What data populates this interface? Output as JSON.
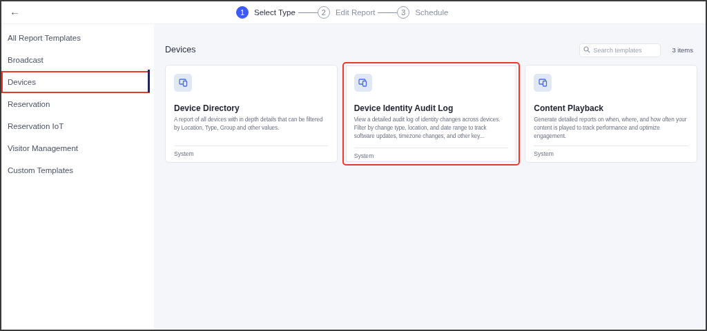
{
  "topbar": {
    "back": "←",
    "steps": [
      {
        "number": "1",
        "label": "Select Type",
        "active": true
      },
      {
        "number": "2",
        "label": "Edit Report",
        "active": false
      },
      {
        "number": "3",
        "label": "Schedule",
        "active": false
      }
    ]
  },
  "sidebar": {
    "items": [
      {
        "label": "All Report Templates",
        "selected": false,
        "highlighted": false
      },
      {
        "label": "Broadcast",
        "selected": false,
        "highlighted": false
      },
      {
        "label": "Devices",
        "selected": true,
        "highlighted": true
      },
      {
        "label": "Reservation",
        "selected": false,
        "highlighted": false
      },
      {
        "label": "Reservation IoT",
        "selected": false,
        "highlighted": false
      },
      {
        "label": "Visitor Management",
        "selected": false,
        "highlighted": false
      },
      {
        "label": "Custom Templates",
        "selected": false,
        "highlighted": false
      }
    ]
  },
  "main": {
    "title": "Devices",
    "search": {
      "placeholder": "Search templates"
    },
    "count": "3 items",
    "cards": [
      {
        "title": "Device Directory",
        "description": "A report of all devices with in depth details that can be filtered by Location, Type, Group and other values.",
        "footer": "System",
        "highlighted": false
      },
      {
        "title": "Device Identity Audit Log",
        "description": "View a detailed audit log of identity changes across devices. Filter by change type, location, and date range to track software updates, timezone changes, and other key...",
        "footer": "System",
        "highlighted": true
      },
      {
        "title": "Content Playback",
        "description": "Generate detailed reports on when, where, and how often your content is played to track performance and optimize engagement.",
        "footer": "System",
        "highlighted": false
      }
    ]
  }
}
